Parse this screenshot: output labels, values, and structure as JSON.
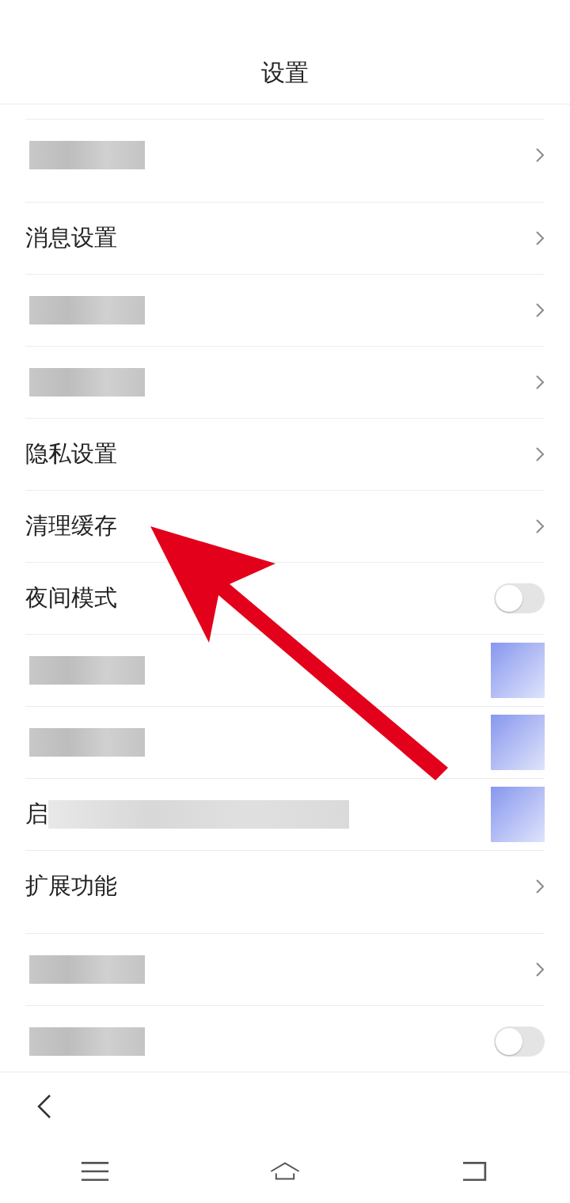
{
  "header": {
    "title": "设置"
  },
  "sections": [
    {
      "rows": [
        {
          "kind": "chevron",
          "redacted": true
        }
      ]
    },
    {
      "rows": [
        {
          "kind": "chevron",
          "label": "消息设置",
          "redacted": false
        },
        {
          "kind": "chevron",
          "redacted": true
        },
        {
          "kind": "chevron",
          "redacted": true
        },
        {
          "kind": "chevron",
          "label": "隐私设置",
          "redacted": false
        },
        {
          "kind": "chevron",
          "label": "清理缓存",
          "redacted": false
        },
        {
          "kind": "toggle",
          "label": "夜间模式",
          "redacted": false,
          "on": false
        },
        {
          "kind": "masked",
          "redacted": true
        },
        {
          "kind": "masked",
          "redacted": true
        },
        {
          "kind": "masked",
          "label": "启",
          "redacted": true
        },
        {
          "kind": "chevron",
          "label": "扩展功能",
          "redacted": false
        }
      ]
    },
    {
      "rows": [
        {
          "kind": "chevron",
          "redacted": true
        },
        {
          "kind": "toggle",
          "redacted": true,
          "on": false
        }
      ]
    }
  ]
}
